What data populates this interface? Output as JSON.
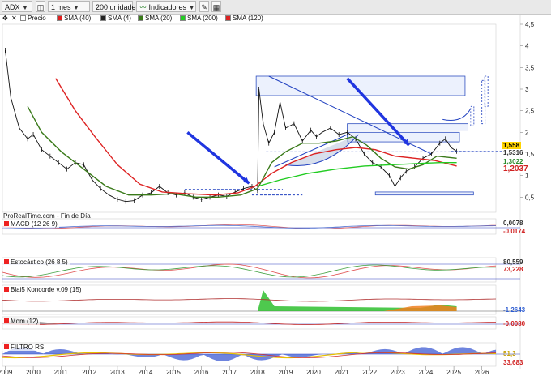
{
  "toolbar": {
    "symbol": "ADX",
    "period": "1 mes",
    "units": "200 unidades",
    "indicators": "Indicadores"
  },
  "legend": [
    {
      "label": "Precio",
      "color": "#ffffff"
    },
    {
      "label": "SMA (40)",
      "color": "#e02020"
    },
    {
      "label": "SMA (4)",
      "color": "#222222"
    },
    {
      "label": "SMA (20)",
      "color": "#3a7a1a"
    },
    {
      "label": "SMA (200)",
      "color": "#22cc22"
    },
    {
      "label": "SMA (120)",
      "color": "#dd2222"
    }
  ],
  "source_text": "ProRealTime.com - Fin de Día",
  "price_badges": [
    {
      "value": "1,558",
      "color": "#ffd400",
      "text_color": "#000000"
    },
    {
      "value": "1,5316",
      "color": "#ffffff",
      "text_color": "#333333"
    },
    {
      "value": "1,3022",
      "color": "#ffffff",
      "text_color": "#2a8a2a"
    },
    {
      "value": "1,2037",
      "color": "#ffffff",
      "text_color": "#d02020"
    }
  ],
  "panels": {
    "macd": {
      "label": "MACD (12 26 9)",
      "values": [
        "0,0078",
        "-0,0174"
      ]
    },
    "stoch": {
      "label": "Estocástico (26 8 5)",
      "values": [
        "80,559",
        "73,228"
      ]
    },
    "koncorde": {
      "label": "Blai5 Koncorde v.09 (15)",
      "values": [
        "-1,2643"
      ]
    },
    "mom": {
      "label": "Mom (12)",
      "values": [
        "-0,0080"
      ]
    },
    "rsi": {
      "label": "FILTRO RSI",
      "values": [
        "51,3",
        "33,683"
      ]
    }
  },
  "chart_data": {
    "type": "line",
    "title": "",
    "xlabel": "",
    "ylabel": "",
    "x_ticks": [
      "2009",
      "2010",
      "2011",
      "2012",
      "2013",
      "2014",
      "2015",
      "2016",
      "2017",
      "2018",
      "2019",
      "2020",
      "2021",
      "2022",
      "2023",
      "2024",
      "2025",
      "2026"
    ],
    "y_ticks": [
      "0,5",
      "1",
      "1,5",
      "2",
      "2,5",
      "3",
      "3,5",
      "4",
      "4,5"
    ],
    "ylim": [
      0.15,
      4.5
    ],
    "xlim": [
      2008.9,
      2026.5
    ],
    "grid": false,
    "series": [
      {
        "name": "Precio",
        "color": "#111111",
        "x": [
          2009.0,
          2009.2,
          2009.5,
          2009.8,
          2010.0,
          2010.3,
          2010.6,
          2010.9,
          2011.2,
          2011.5,
          2011.8,
          2012.1,
          2012.4,
          2012.7,
          2013.0,
          2013.3,
          2013.6,
          2013.9,
          2014.2,
          2014.5,
          2014.8,
          2015.1,
          2015.4,
          2015.7,
          2016.0,
          2016.3,
          2016.6,
          2016.9,
          2017.2,
          2017.5,
          2017.8,
          2018.0,
          2018.05,
          2018.2,
          2018.4,
          2018.6,
          2018.8,
          2019.0,
          2019.3,
          2019.6,
          2019.9,
          2020.1,
          2020.3,
          2020.6,
          2020.9,
          2021.2,
          2021.5,
          2021.8,
          2022.1,
          2022.4,
          2022.7,
          2022.9,
          2023.1,
          2023.3,
          2023.6,
          2023.9,
          2024.2,
          2024.5,
          2024.7,
          2024.9,
          2025.1
        ],
        "y": [
          3.9,
          2.8,
          2.1,
          1.85,
          1.95,
          1.6,
          1.45,
          1.3,
          1.15,
          1.3,
          1.25,
          0.9,
          0.7,
          0.55,
          0.45,
          0.4,
          0.42,
          0.55,
          0.6,
          0.75,
          0.6,
          0.55,
          0.6,
          0.5,
          0.45,
          0.5,
          0.55,
          0.52,
          0.62,
          0.7,
          0.75,
          0.65,
          3.0,
          2.2,
          1.75,
          2.0,
          2.7,
          2.1,
          2.2,
          1.8,
          2.05,
          1.9,
          2.0,
          2.1,
          1.95,
          2.0,
          1.85,
          1.5,
          1.3,
          1.2,
          1.0,
          0.75,
          0.95,
          1.1,
          1.2,
          1.4,
          1.5,
          1.75,
          1.85,
          1.65,
          1.56
        ]
      },
      {
        "name": "SMA (40)",
        "color": "#dd2222",
        "x": [
          2010.8,
          2011.5,
          2012.2,
          2013.0,
          2013.8,
          2014.6,
          2015.5,
          2016.5,
          2017.3,
          2017.9,
          2018.5,
          2019.2,
          2020.0,
          2020.8,
          2021.5,
          2022.2,
          2022.9,
          2023.6,
          2024.3,
          2025.1
        ],
        "y": [
          3.25,
          2.5,
          1.9,
          1.25,
          0.8,
          0.62,
          0.58,
          0.55,
          0.6,
          0.75,
          1.05,
          1.3,
          1.5,
          1.6,
          1.65,
          1.6,
          1.45,
          1.4,
          1.35,
          1.22
        ]
      },
      {
        "name": "SMA (20)",
        "color": "#3a7a1a",
        "x": [
          2009.8,
          2010.3,
          2011.0,
          2011.8,
          2012.6,
          2013.4,
          2014.2,
          2015.0,
          2015.8,
          2016.6,
          2017.4,
          2018.0,
          2018.5,
          2019.0,
          2019.6,
          2020.2,
          2020.8,
          2021.4,
          2021.9,
          2022.4,
          2022.9,
          2023.4,
          2023.9,
          2024.4,
          2025.1
        ],
        "y": [
          2.6,
          2.0,
          1.55,
          1.15,
          0.75,
          0.55,
          0.55,
          0.58,
          0.5,
          0.5,
          0.55,
          0.7,
          1.3,
          1.55,
          1.75,
          1.75,
          1.8,
          1.9,
          1.7,
          1.4,
          1.2,
          1.15,
          1.25,
          1.45,
          1.4
        ]
      },
      {
        "name": "SMA (200)",
        "color": "#22cc22",
        "x": [
          2018.0,
          2018.8,
          2019.8,
          2020.8,
          2021.8,
          2022.8,
          2023.8,
          2024.5,
          2025.1
        ],
        "y": [
          0.75,
          0.9,
          1.05,
          1.15,
          1.22,
          1.25,
          1.28,
          1.3,
          1.3
        ]
      }
    ],
    "annotations": [
      "trend-arrows",
      "trendlines",
      "rectangles",
      "cup-pattern"
    ]
  }
}
